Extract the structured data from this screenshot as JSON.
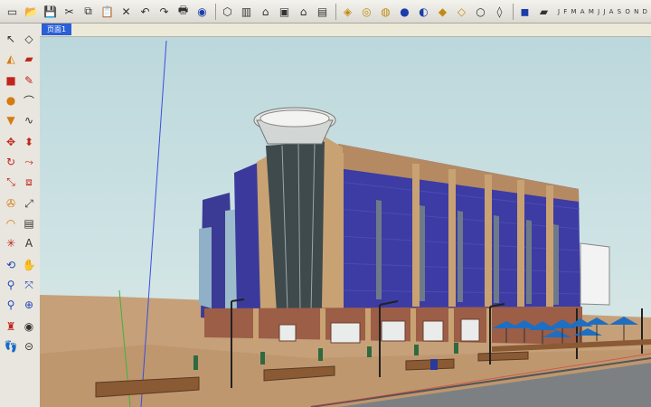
{
  "toolbar": {
    "months": "J F M A M J J A S O N D"
  },
  "tab": {
    "label": "页面1"
  },
  "icons": {
    "top": [
      "new-icon",
      "open-icon",
      "save-icon",
      "cut-icon",
      "copy-icon",
      "paste-icon",
      "erase-icon",
      "undo-icon",
      "redo-icon",
      "print-icon",
      "info-icon",
      "iso-view-icon",
      "top-view-icon",
      "front-view-icon",
      "right-view-icon",
      "back-view-icon",
      "left-view-icon",
      "xray-icon",
      "wireframe-icon",
      "hidden-line-icon",
      "shaded-icon",
      "textured-icon",
      "monochrome-icon",
      "section-icon",
      "shadow-icon",
      "fog-icon"
    ],
    "palette": [
      "select-icon",
      "component-icon",
      "paint-bucket-icon",
      "eraser-icon",
      "rectangle-icon",
      "line-icon",
      "circle-icon",
      "arc-icon",
      "polygon-icon",
      "freehand-icon",
      "move-icon",
      "push-pull-icon",
      "rotate-icon",
      "follow-me-icon",
      "scale-icon",
      "offset-icon",
      "tape-measure-icon",
      "dimension-icon",
      "protractor-icon",
      "text-icon",
      "axes-icon",
      "3d-text-icon",
      "orbit-icon",
      "pan-icon",
      "zoom-icon",
      "zoom-window-icon",
      "previous-view-icon",
      "zoom-extents-icon",
      "position-camera-icon",
      "look-around-icon",
      "walk-icon",
      "section-plane-icon"
    ]
  },
  "colors": {
    "sky": "#c8e0e2",
    "facade_blue": "#3c3c9e",
    "masonry": "#b58a62",
    "ground": "#c8a37a",
    "road": "#7a7f82",
    "umbrella": "#1e6fc2",
    "active_tab": "#2b5fd8"
  }
}
